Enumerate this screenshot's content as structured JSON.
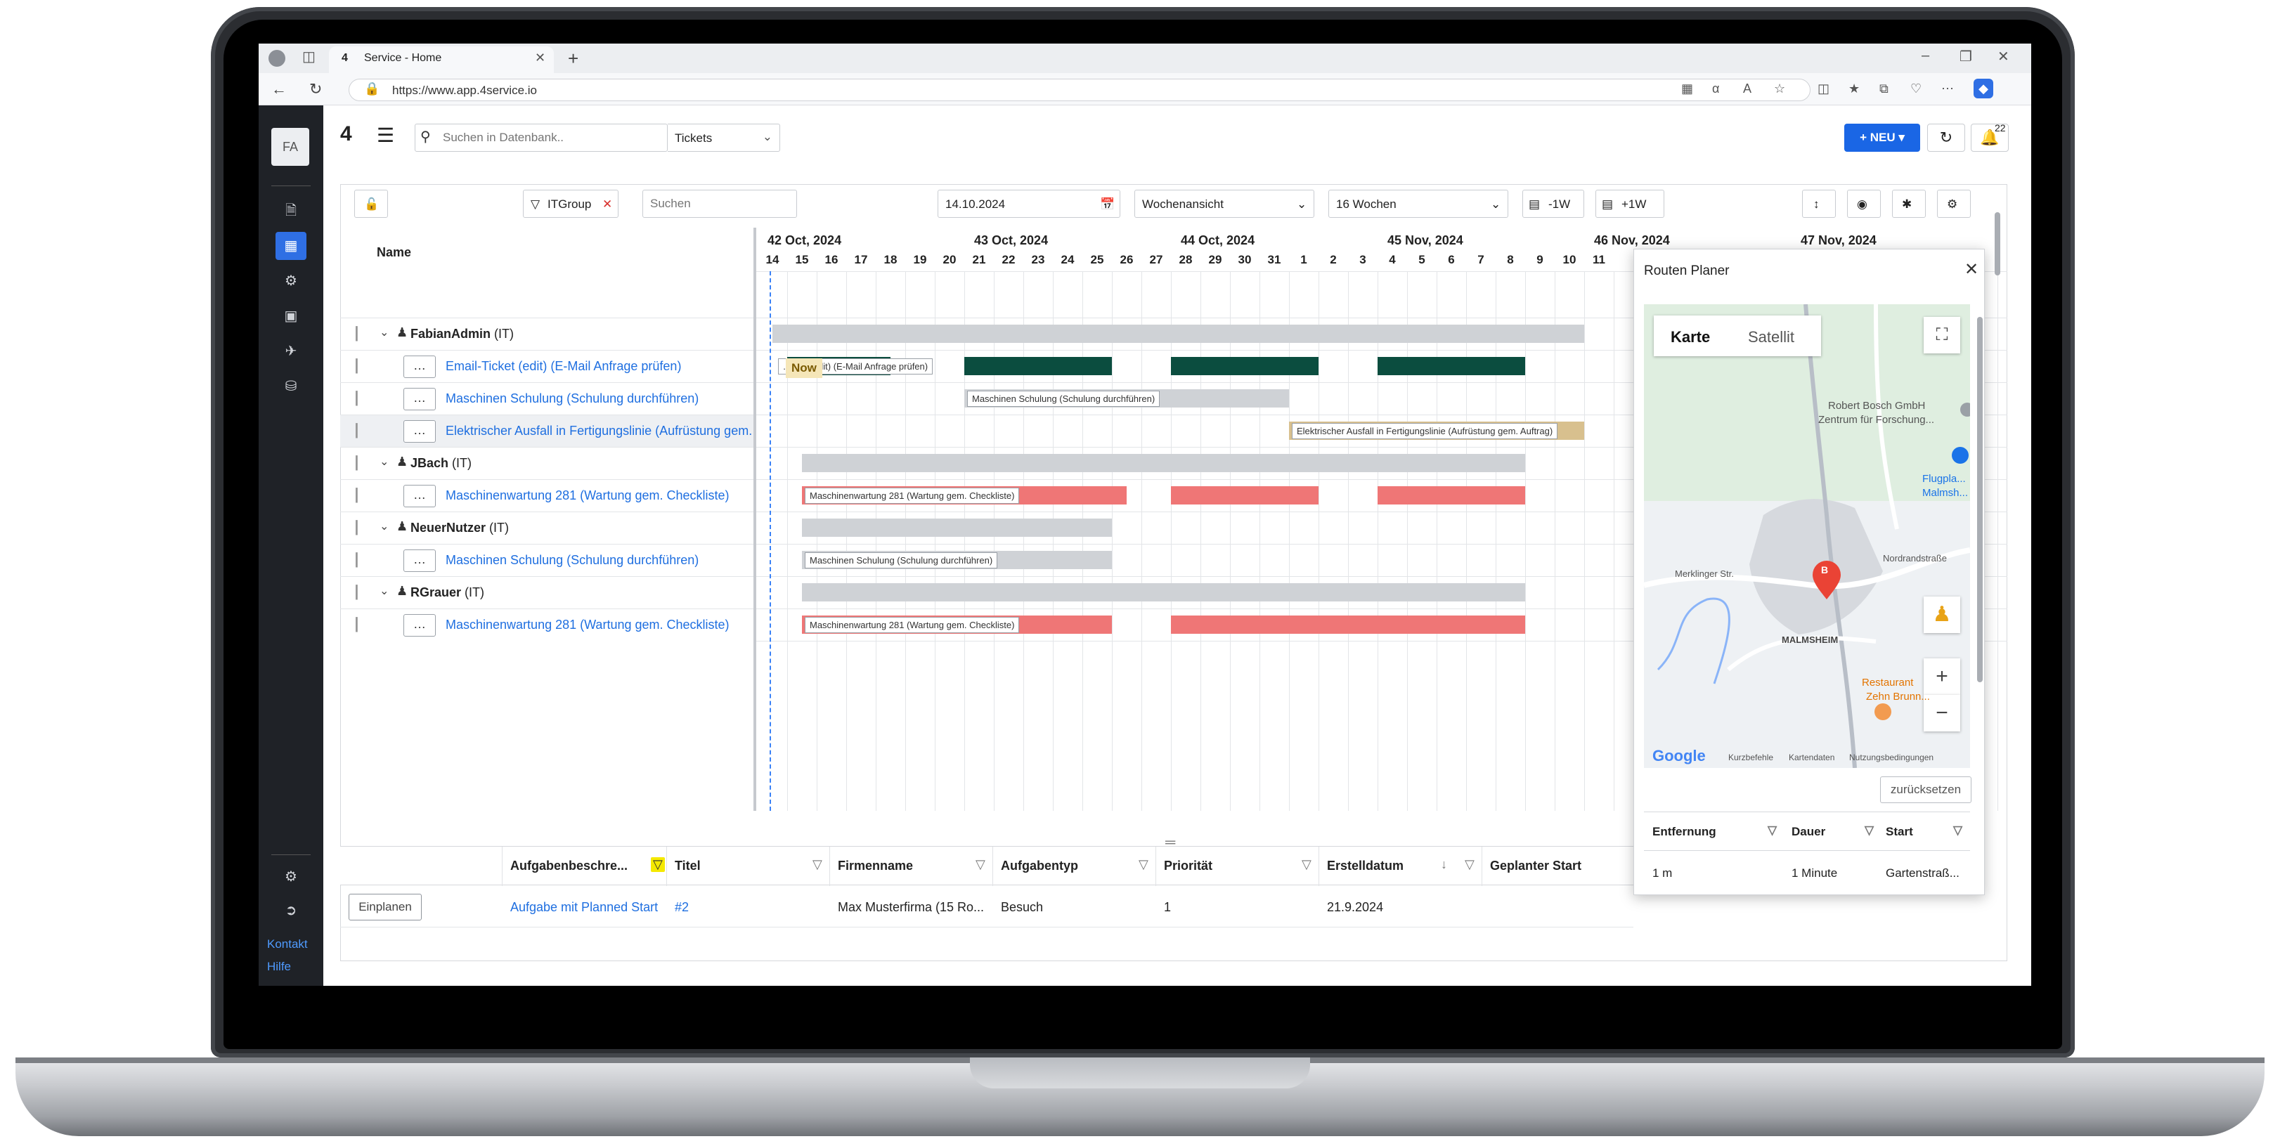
{
  "browser": {
    "tab_title": "Service - Home",
    "url": "https://www.app.4service.io"
  },
  "sidebar": {
    "avatar_initials": "FA",
    "links": {
      "contact": "Kontakt",
      "help": "Hilfe"
    }
  },
  "topbar": {
    "search_placeholder": "Suchen in Datenbank..",
    "search_scope": "Tickets",
    "new_label": "NEU",
    "notification_count": "22"
  },
  "gantt": {
    "toolbar": {
      "group_filter": "ITGroup",
      "search_placeholder": "Suchen",
      "date": "14.10.2024",
      "view": "Wochenansicht",
      "range": "16 Wochen",
      "back_week": "-1W",
      "forward_week": "+1W"
    },
    "name_header": "Name",
    "weeks": [
      "42 Oct, 2024",
      "43 Oct, 2024",
      "44 Oct, 2024",
      "45 Nov, 2024",
      "46 Nov, 2024",
      "47 Nov, 2024"
    ],
    "days": [
      "14",
      "15",
      "16",
      "17",
      "18",
      "19",
      "20",
      "21",
      "22",
      "23",
      "24",
      "25",
      "26",
      "27",
      "28",
      "29",
      "30",
      "31",
      "1",
      "2",
      "3",
      "4",
      "5",
      "6",
      "7",
      "8",
      "9",
      "10",
      "11"
    ],
    "now_label": "Now",
    "rows": [
      {
        "kind": "group",
        "name": "FabianAdmin",
        "group": "(IT)"
      },
      {
        "kind": "task",
        "title": "Email-Ticket (edit) (E-Mail Anfrage prüfen)",
        "bar_label": "...cket (edit) (E-Mail Anfrage prüfen)"
      },
      {
        "kind": "task",
        "title": "Maschinen Schulung (Schulung durchführen)",
        "bar_label": "Maschinen Schulung (Schulung durchführen)"
      },
      {
        "kind": "task",
        "title": "Elektrischer Ausfall in Fertigungslinie (Aufrüstung gem. Auftrag)",
        "bar_label": "Elektrischer Ausfall in Fertigungslinie (Aufrüstung gem. Auftrag)"
      },
      {
        "kind": "group",
        "name": "JBach",
        "group": "(IT)"
      },
      {
        "kind": "task",
        "title": "Maschinenwartung 281 (Wartung gem. Checkliste)",
        "bar_label": "Maschinenwartung 281 (Wartung gem. Checkliste)"
      },
      {
        "kind": "group",
        "name": "NeuerNutzer",
        "group": "(IT)"
      },
      {
        "kind": "task",
        "title": "Maschinen Schulung (Schulung durchführen)",
        "bar_label": "Maschinen Schulung (Schulung durchführen)"
      },
      {
        "kind": "group",
        "name": "RGrauer",
        "group": "(IT)"
      },
      {
        "kind": "task",
        "title": "Maschinenwartung 281 (Wartung gem. Checkliste)",
        "bar_label": "Maschinenwartung 281 (Wartung gem. Checkliste)"
      }
    ]
  },
  "route_planner": {
    "title": "Routen Planer",
    "map_tabs": [
      "Karte",
      "Satellit"
    ],
    "map_labels": {
      "place1": "Robert Bosch GmbH",
      "place1b": "Zentrum für Forschung...",
      "place2": "Flugpla...",
      "place2b": "Malmsh...",
      "town": "MALMSHEIM",
      "street1": "Merklinger Str.",
      "street2": "Nordrandstraße",
      "restaurant": "Restaurant",
      "restaurant2": "Zehn Brunn...",
      "marker": "B",
      "google": "Google",
      "footer1": "Kurzbefehle",
      "footer2": "Kartendaten",
      "footer3": "Nutzungsbedingungen"
    },
    "reset_label": "zurücksetzen",
    "columns": [
      "Entfernung",
      "Dauer",
      "Start"
    ],
    "row": [
      "1 m",
      "1 Minute",
      "Gartenstraß..."
    ]
  },
  "tasks_grid": {
    "columns": [
      "Aufgabenbeschre...",
      "Titel",
      "Firmenname",
      "Aufgabentyp",
      "Priorität",
      "Erstelldatum",
      "Geplanter Start"
    ],
    "row": {
      "button": "Einplanen",
      "description": "Aufgabe mit Planned Start",
      "title": "#2",
      "company": "Max Musterfirma (15 Ro...",
      "type": "Besuch",
      "priority": "1",
      "created": "21.9.2024"
    }
  },
  "colors": {
    "accent": "#1a66e5",
    "bar_green": "#0b4d3f",
    "bar_red": "#ef7676",
    "bar_gray": "#cfd2d6",
    "bar_tan": "#d8c08e",
    "sidebar": "#1f2227"
  }
}
